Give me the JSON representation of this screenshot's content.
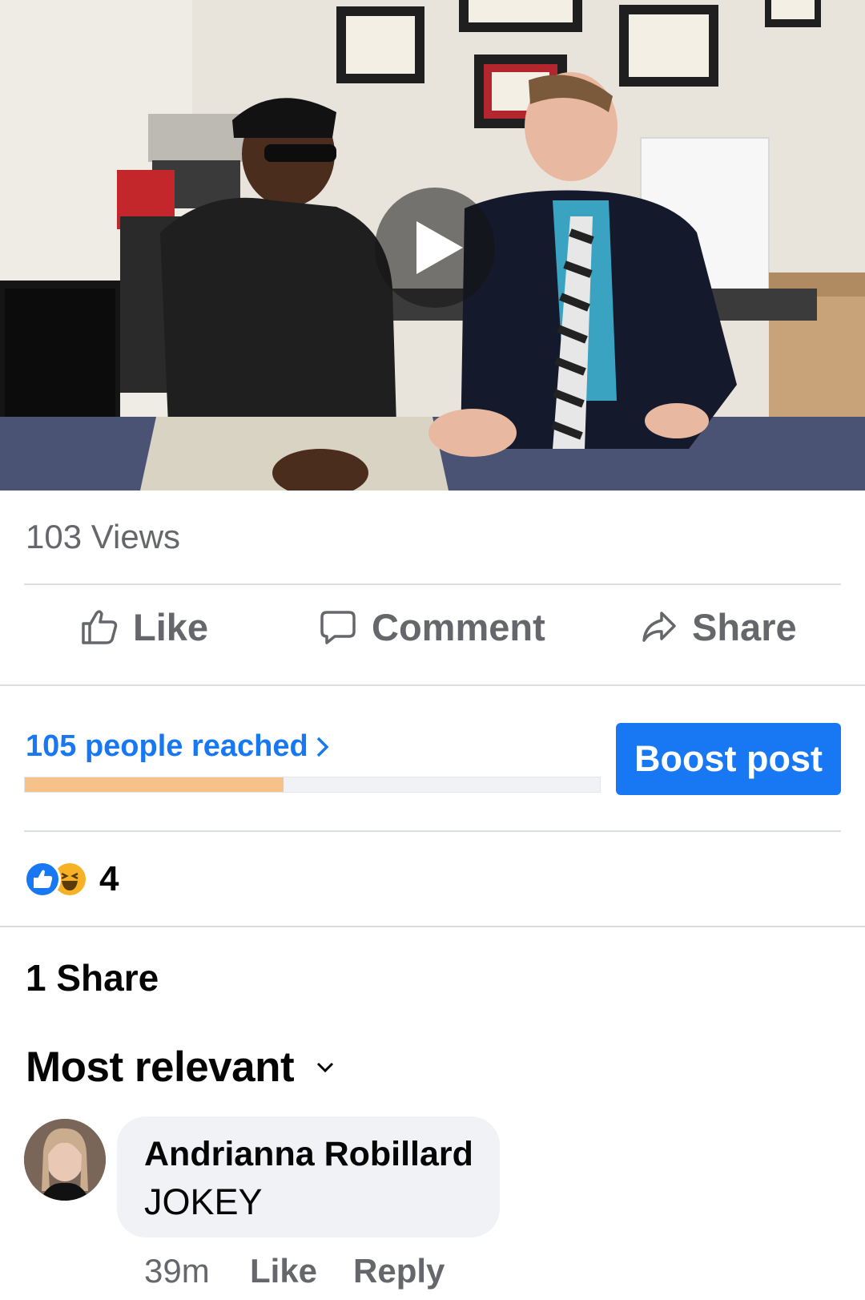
{
  "video": {
    "alt": "Video thumbnail of two men talking in an office",
    "play_icon": "play-icon"
  },
  "stats": {
    "views": "103 Views"
  },
  "actions": {
    "like": {
      "label": "Like",
      "icon": "thumbs-up-icon"
    },
    "comment": {
      "label": "Comment",
      "icon": "comment-bubble-icon"
    },
    "share": {
      "label": "Share",
      "icon": "share-arrow-icon"
    }
  },
  "reach": {
    "label": "105 people reached",
    "chevron_icon": "chevron-right-icon",
    "progress_fraction": 0.45,
    "progress_color": "#f7c28a"
  },
  "boost": {
    "label": "Boost post",
    "color": "#1877f2"
  },
  "reactions": {
    "icons": [
      "like-reaction-icon",
      "haha-reaction-icon"
    ],
    "count": "4"
  },
  "shares": {
    "label": "1 Share"
  },
  "comments_sort": {
    "label": "Most relevant",
    "icon": "chevron-down-icon"
  },
  "comments": [
    {
      "author": "Andrianna Robillard",
      "text": "JOKEY",
      "time": "39m",
      "like_label": "Like",
      "reply_label": "Reply"
    }
  ]
}
